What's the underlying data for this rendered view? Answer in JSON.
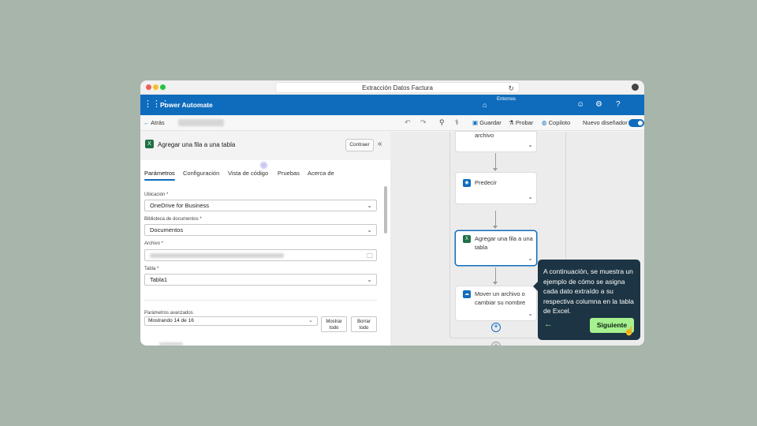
{
  "browser": {
    "url_title": "Extracción Datos Factura"
  },
  "appbar": {
    "app_name": "Power Automate",
    "environment_label": "Entornos"
  },
  "cmdbar": {
    "back_label": "Atrás",
    "save_label": "Guardar",
    "test_label": "Probar",
    "copilot_label": "Copiloto",
    "new_designer_label": "Nuevo diseñador",
    "new_designer_on": true
  },
  "panel": {
    "title": "Agregar una fila a una tabla",
    "collapse_label": "Contraer",
    "tabs": [
      "Parámetros",
      "Configuración",
      "Vista de código",
      "Pruebas",
      "Acerca de"
    ],
    "active_tab": "Parámetros",
    "fields": {
      "location_label": "Ubicación *",
      "location_value": "OneDrive for Business",
      "library_label": "Biblioteca de documentos *",
      "library_value": "Documentos",
      "file_label": "Archivo *",
      "table_label": "Tabla *",
      "table_value": "Tabla1"
    },
    "advanced": {
      "label": "Parámetros avanzados",
      "select_value": "Mostrando 14 de 16",
      "show_all_line1": "Mostrar",
      "show_all_line2": "todo",
      "clear_all_line1": "Borrar",
      "clear_all_line2": "todo"
    }
  },
  "flow": {
    "steps": [
      {
        "label_line1": "archivo",
        "label_line2": ""
      },
      {
        "label_line1": "Predecir",
        "label_line2": ""
      },
      {
        "label_line1": "Agregar una fila a una",
        "label_line2": "tabla"
      },
      {
        "label_line1": "Mover un archivo o",
        "label_line2": "cambiar su nombre"
      }
    ]
  },
  "tooltip": {
    "text": "A continuación, se muestra un ejemplo de cómo se asigna cada dato extraído a su respectiva columna en la tabla de Excel.",
    "next_label": "Siguiente"
  },
  "colors": {
    "brand": "#0f6cbd",
    "tooltip_bg": "#1c3443",
    "next_button": "#a6f08f",
    "background": "#a7b5aa"
  }
}
